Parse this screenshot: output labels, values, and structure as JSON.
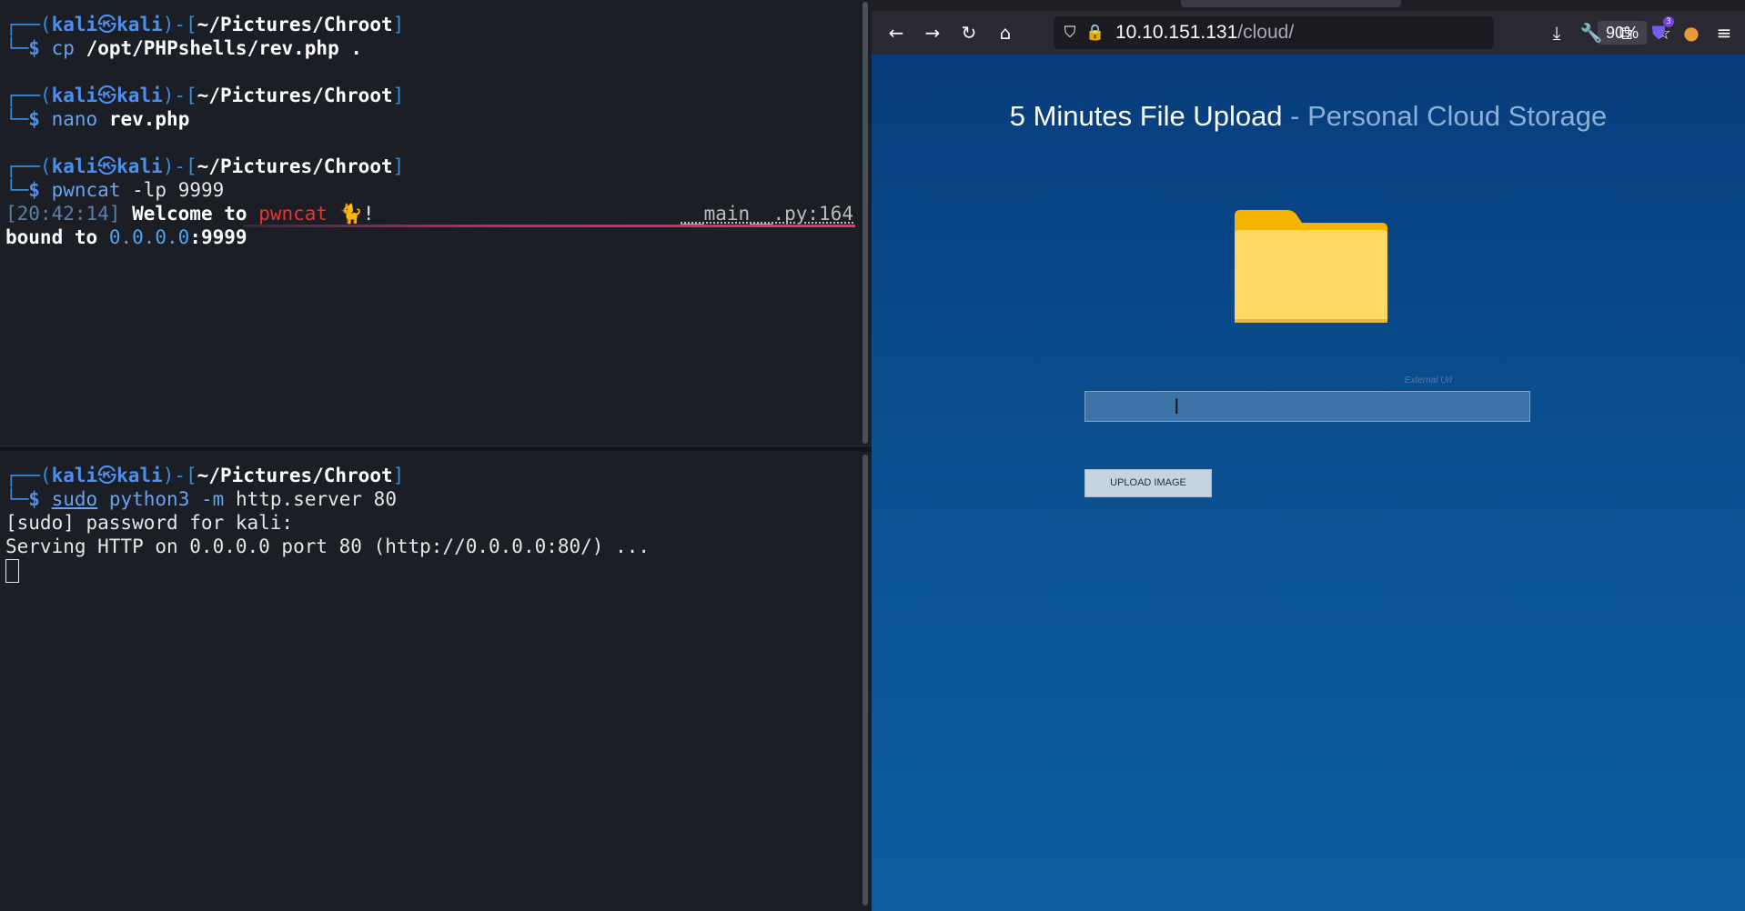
{
  "terminal": {
    "top_pane": {
      "blocks": [
        {
          "user": "kali",
          "host": "kali",
          "cwd": "~/Pictures/Chroot",
          "command": "cp",
          "args": "/opt/PHPshells/rev.php ."
        },
        {
          "user": "kali",
          "host": "kali",
          "cwd": "~/Pictures/Chroot",
          "command": "nano",
          "args": "rev.php"
        },
        {
          "user": "kali",
          "host": "kali",
          "cwd": "~/Pictures/Chroot",
          "command": "pwncat",
          "args": "-lp 9999"
        }
      ],
      "log": {
        "timestamp": "[20:42:14]",
        "welcome": "Welcome to",
        "app": "pwncat",
        "emoji": "🐈!",
        "source": "__main__.py:164",
        "bound_text": "bound to",
        "bound_ip": "0.0.0.0",
        "bound_port": ":9999"
      }
    },
    "bottom_pane": {
      "user": "kali",
      "host": "kali",
      "cwd": "~/Pictures/Chroot",
      "sudo": "sudo",
      "command": "python3",
      "args_flag": "-m",
      "args": "http.server 80",
      "out1": "[sudo] password for kali:",
      "out2": "Serving HTTP on 0.0.0.0 port 80 (http://0.0.0.0:80/) ..."
    },
    "prompt": {
      "open": "┌──(",
      "skull": "㉿",
      "mid": ")-[",
      "close": "]",
      "corner": "└─",
      "dollar": "$"
    }
  },
  "browser": {
    "url_host": "10.10.151.131",
    "url_path": "/cloud/",
    "zoom": "90%",
    "extensions_badge": "3",
    "icons": [
      "back-icon",
      "forward-icon",
      "reload-icon",
      "home-icon",
      "shield-icon",
      "lock-icon",
      "bookmark-star-icon",
      "download-icon",
      "wrench-icon",
      "extensions-icon",
      "menu-icon"
    ]
  },
  "page": {
    "title_main": "5 Minutes File Upload",
    "title_sub": " - Personal Cloud Storage",
    "external_label": "External Url",
    "input_value": "",
    "upload_button": "UPLOAD IMAGE",
    "colors": {
      "bg_top": "#073c7c",
      "bg_bottom": "#0c5da0",
      "folder": "#ffd865",
      "folder_tab": "#f5b400"
    }
  }
}
